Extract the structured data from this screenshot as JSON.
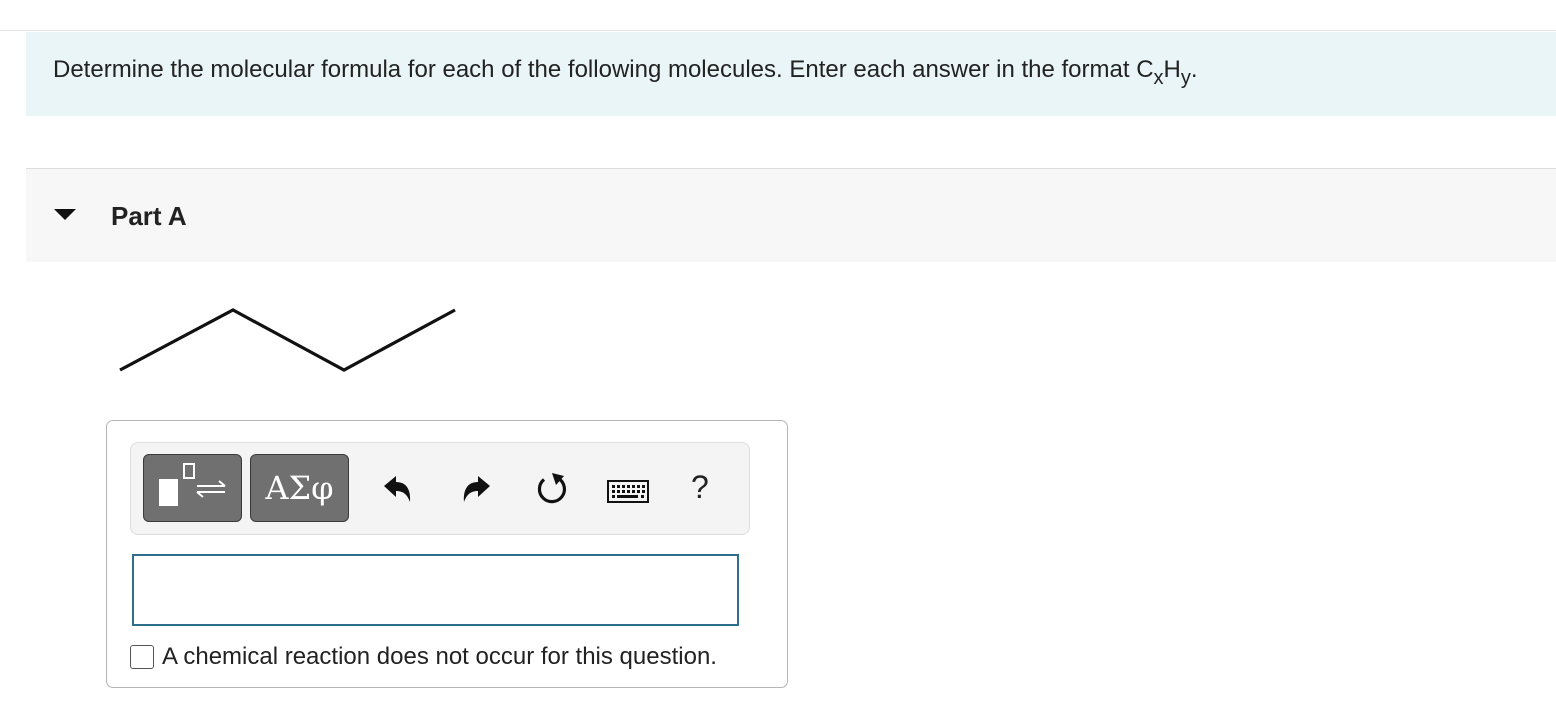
{
  "instructions": {
    "text": "Determine the molecular formula for each of the following molecules.  Enter each answer in the format C",
    "format_sub_x": "x",
    "format_h": "H",
    "format_sub_y": "y",
    "format_end": "."
  },
  "part": {
    "title": "Part A",
    "expanded": true
  },
  "toolbar": {
    "symbols_label": "ΑΣφ",
    "help_label": "?",
    "icons": [
      "templates-icon",
      "greek-symbols",
      "undo-icon",
      "redo-icon",
      "reset-icon",
      "keyboard-icon",
      "help-icon"
    ]
  },
  "answer": {
    "value": ""
  },
  "no_reaction": {
    "label": "A chemical reaction does not occur for this question.",
    "checked": false
  },
  "colors": {
    "instructions_bg": "#eaf5f7",
    "part_header_bg": "#f7f7f7",
    "toolbar_button": "#707070",
    "input_border": "#2f6e8c"
  }
}
